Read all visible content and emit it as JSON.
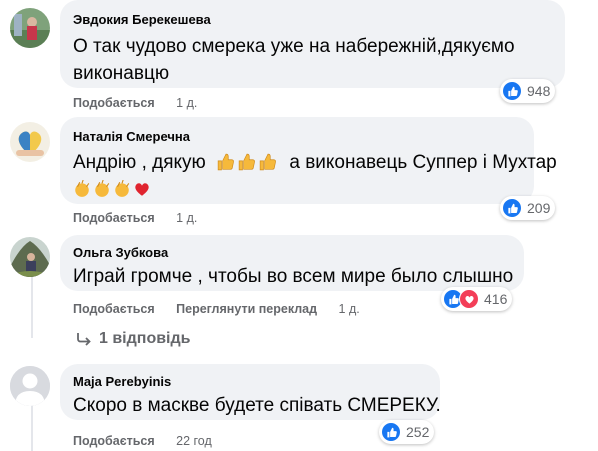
{
  "comments": [
    {
      "author": "Эвдокия Берекешева",
      "text": "О так чудово смерека уже на набережній,дякуємо виконавцю",
      "like_label": "Подобається",
      "time": "1 д.",
      "reaction_count": "948",
      "reactions": [
        "like-icon"
      ]
    },
    {
      "author": "Наталія Смеречна",
      "text_line1": "Андрію , дякую",
      "text_line1_after": "а виконавець Суппер і Мухтар",
      "emoji_inline": [
        "thumbs-up-emoji",
        "thumbs-up-emoji",
        "thumbs-up-emoji"
      ],
      "emoji_line2": [
        "clapping-hands-emoji",
        "clapping-hands-emoji",
        "clapping-hands-emoji",
        "red-heart-emoji"
      ],
      "like_label": "Подобається",
      "time": "1 д.",
      "reaction_count": "209",
      "reactions": [
        "like-icon"
      ]
    },
    {
      "author": "Ольга Зубкова",
      "text": "Играй громче , чтобы во всем мире было слышно",
      "like_label": "Подобається",
      "translate_label": "Переглянути переклад",
      "time": "1 д.",
      "reaction_count": "416",
      "reactions": [
        "like-icon",
        "love-icon"
      ],
      "replies_label": "1 відповідь"
    },
    {
      "author": "Maja Perebyinis",
      "text": "Скоро в маскве будете співать СМЕРЕКУ.",
      "like_label": "Подобається",
      "time": "22 год",
      "reaction_count": "252",
      "reactions": [
        "like-icon"
      ]
    }
  ],
  "colors": {
    "bubble": "#f0f2f5",
    "like": "#1877f2",
    "love": "#f33e58",
    "meta_text": "#65676b"
  }
}
